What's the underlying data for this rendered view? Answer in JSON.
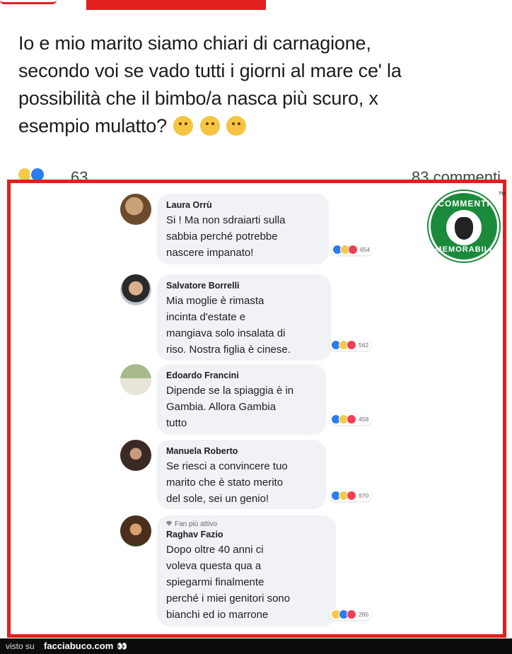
{
  "post": {
    "line1": "Io e mio marito siamo chiari di carnagione,",
    "line2": "secondo voi se vado tutti i giorni al mare ce' la",
    "line3": "possibilità che il bimbo/a nasca più scuro, x",
    "line4": "esempio mulatto?",
    "reaction_count": "63",
    "comments_count": "83 commenti"
  },
  "comments": [
    {
      "name": "Laura Orrù",
      "text": "Si ! Ma non sdraiarti sulla\nsabbia perché potrebbe\nnascere impanato!",
      "reactions": "654"
    },
    {
      "name": "Salvatore Borrelli",
      "text": "Mia moglie è rimasta\nincinta d'estate e\nmangiava solo insalata di\nriso. Nostra figlia è cinese.",
      "reactions": "562"
    },
    {
      "name": "Edoardo Francini",
      "text": "Dipende se la spiaggia è in\nGambia. Allora Gambia\ntutto",
      "reactions": "458"
    },
    {
      "name": "Manuela Roberto",
      "text": "Se riesci a convincere tuo\nmarito che è stato merito\ndel sole, sei un genio!",
      "reactions": "970"
    },
    {
      "badge": "Fan più attivo",
      "name": "Raghav Fazio",
      "text": "Dopo oltre 40 anni ci\nvoleva questa qua a\nspiegarmi finalmente\nperché i miei genitori sono\nbianchi ed io marrone",
      "reactions": "265"
    }
  ],
  "logo": {
    "top": "COMMENTI",
    "bottom": "MEMORABILI",
    "tm": "TM"
  },
  "footer": {
    "visto": "visto su",
    "site": "facciabuco.com",
    "eyes": "👀"
  },
  "colors": {
    "frame": "#e0201e",
    "logo_green": "#1b8a3a",
    "bubble": "#f0f2f5"
  }
}
